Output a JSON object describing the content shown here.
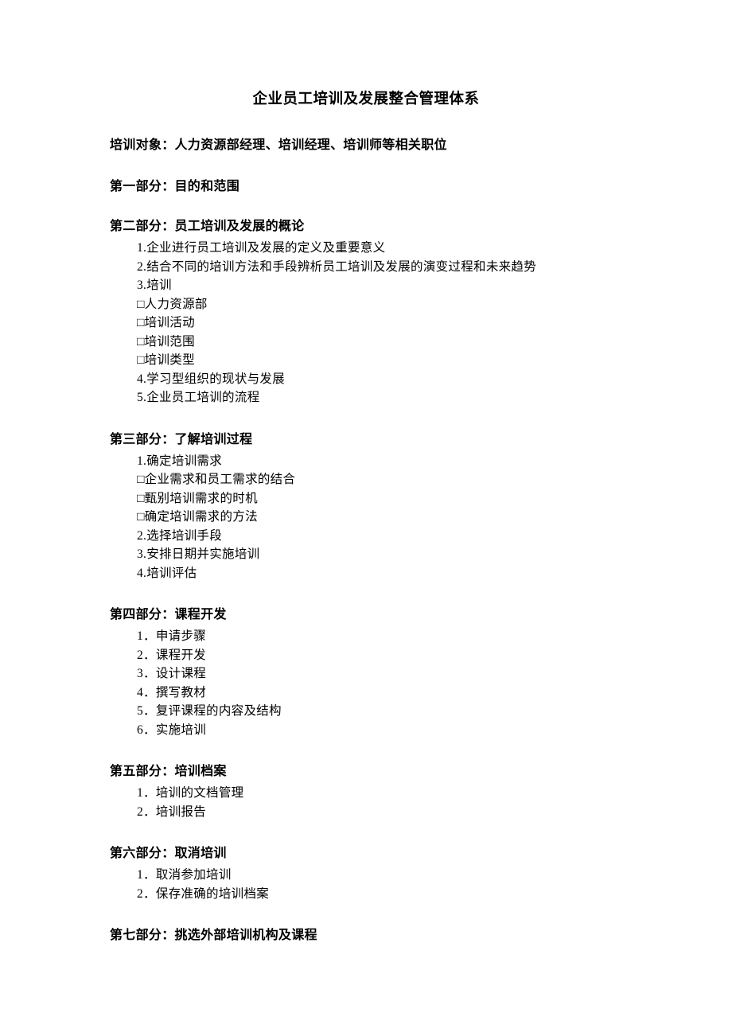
{
  "title": "企业员工培训及发展整合管理体系",
  "subtitle": "培训对象：人力资源部经理、培训经理、培训师等相关职位",
  "sections": [
    {
      "heading": "第一部分：目的和范围",
      "items": []
    },
    {
      "heading": "第二部分：员工培训及发展的概论",
      "items": [
        {
          "text": "1.企业进行员工培训及发展的定义及重要意义",
          "type": "plain"
        },
        {
          "text": "2.结合不同的培训方法和手段辨析员工培训及发展的演变过程和未来趋势",
          "type": "plain"
        },
        {
          "text": "3.培训",
          "type": "plain"
        },
        {
          "text": "人力资源部",
          "type": "checkbox"
        },
        {
          "text": "培训活动",
          "type": "checkbox"
        },
        {
          "text": "培训范围",
          "type": "checkbox"
        },
        {
          "text": "培训类型",
          "type": "checkbox"
        },
        {
          "text": "4.学习型组织的现状与发展",
          "type": "plain"
        },
        {
          "text": "5.企业员工培训的流程",
          "type": "plain"
        }
      ]
    },
    {
      "heading": "第三部分：了解培训过程",
      "items": [
        {
          "text": "1.确定培训需求",
          "type": "plain"
        },
        {
          "text": "企业需求和员工需求的结合",
          "type": "checkbox"
        },
        {
          "text": "甄别培训需求的时机",
          "type": "checkbox"
        },
        {
          "text": "确定培训需求的方法",
          "type": "checkbox"
        },
        {
          "text": "2.选择培训手段",
          "type": "plain"
        },
        {
          "text": "3.安排日期并实施培训",
          "type": "plain"
        },
        {
          "text": "4.培训评估",
          "type": "plain"
        }
      ]
    },
    {
      "heading": "第四部分：课程开发",
      "items": [
        {
          "text": "1．申请步骤",
          "type": "plain"
        },
        {
          "text": "2．课程开发",
          "type": "plain"
        },
        {
          "text": "3．设计课程",
          "type": "plain"
        },
        {
          "text": "4．撰写教材",
          "type": "plain"
        },
        {
          "text": "5．复评课程的内容及结构",
          "type": "plain"
        },
        {
          "text": "6．实施培训",
          "type": "plain"
        }
      ]
    },
    {
      "heading": "第五部分：培训档案",
      "items": [
        {
          "text": "1．培训的文档管理",
          "type": "plain"
        },
        {
          "text": "2．培训报告",
          "type": "plain"
        }
      ]
    },
    {
      "heading": "第六部分：取消培训",
      "items": [
        {
          "text": "1．取消参加培训",
          "type": "plain"
        },
        {
          "text": "2．保存准确的培训档案",
          "type": "plain"
        }
      ]
    },
    {
      "heading": "第七部分：挑选外部培训机构及课程",
      "items": []
    }
  ]
}
